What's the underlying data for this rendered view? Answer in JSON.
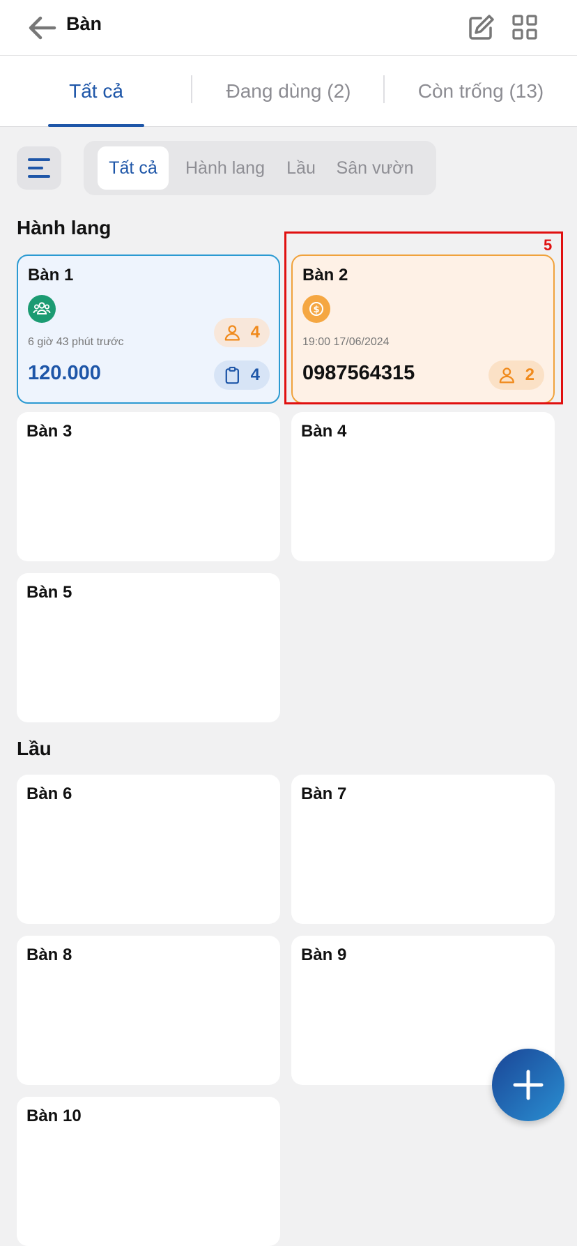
{
  "header": {
    "title": "Bàn"
  },
  "tabs": [
    {
      "label": "Tất cả"
    },
    {
      "label": "Đang dùng (2)"
    },
    {
      "label": "Còn trống (13)"
    }
  ],
  "areas": [
    {
      "label": "Tất cả"
    },
    {
      "label": "Hành lang"
    },
    {
      "label": "Lầu"
    },
    {
      "label": "Sân vườn"
    }
  ],
  "sections": [
    {
      "title": "Hành lang"
    },
    {
      "title": "Lầu"
    }
  ],
  "tables": {
    "t1": {
      "name": "Bàn 1",
      "time": "6 giờ 43 phút trước",
      "amount": "120.000",
      "guests": "4",
      "orders": "4"
    },
    "t2": {
      "name": "Bàn 2",
      "time": "19:00 17/06/2024",
      "phone": "0987564315",
      "guests": "2"
    },
    "t3": {
      "name": "Bàn 3"
    },
    "t4": {
      "name": "Bàn 4"
    },
    "t5": {
      "name": "Bàn 5"
    },
    "t6": {
      "name": "Bàn 6"
    },
    "t7": {
      "name": "Bàn 7"
    },
    "t8": {
      "name": "Bàn 8"
    },
    "t9": {
      "name": "Bàn 9"
    },
    "t10": {
      "name": "Bàn 10"
    }
  },
  "annotation": {
    "label": "5"
  },
  "colors": {
    "primary": "#1e56a8",
    "busy_border": "#2b9ad2",
    "reserved_border": "#f0a23c",
    "orange": "#f08a1c",
    "green": "#1b9b72",
    "highlight": "#e01010"
  },
  "icons": [
    "back-arrow-icon",
    "edit-icon",
    "grid-icon",
    "filter-menu-icon",
    "group-icon",
    "dollar-icon",
    "person-icon",
    "clipboard-icon",
    "plus-icon"
  ]
}
